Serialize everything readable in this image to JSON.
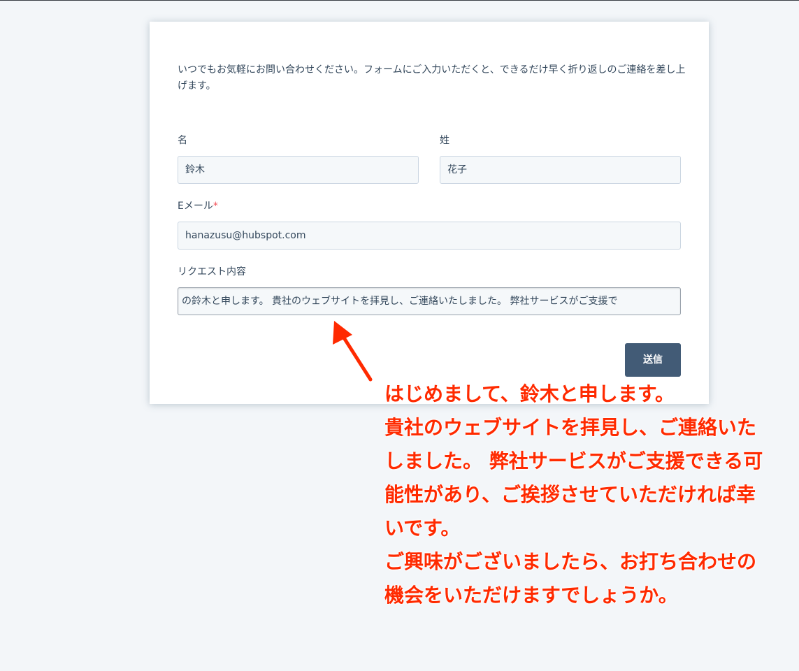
{
  "form": {
    "intro": "いつでもお気軽にお問い合わせください。フォームにご入力いただくと、できるだけ早く折り返しのご連絡を差し上げます。",
    "first_name_label": "名",
    "first_name_value": "鈴木",
    "last_name_label": "姓",
    "last_name_value": "花子",
    "email_label": "Eメール",
    "required_mark": "*",
    "email_value": "hanazusu@hubspot.com",
    "request_label": "リクエスト内容",
    "request_value": "の鈴木と申します。 貴社のウェブサイトを拝見し、ご連絡いたしました。 弊社サービスがご支援で",
    "submit_label": "送信"
  },
  "annotation": {
    "lines": [
      "はじめまして、鈴木と申します。",
      " 貴社のウェブサイトを拝見し、ご連絡いた",
      "しました。 弊社サービスがご支援できる可",
      "能性があり、ご挨拶させていただければ幸",
      "いです。",
      "ご興味がございましたら、お打ち合わせの",
      "機会をいただけますでしょうか。"
    ],
    "color": "#ff2a00"
  },
  "colors": {
    "page_bg": "#f3f6f9",
    "text": "#33475b",
    "button": "#425b76",
    "required": "#f2545b"
  }
}
